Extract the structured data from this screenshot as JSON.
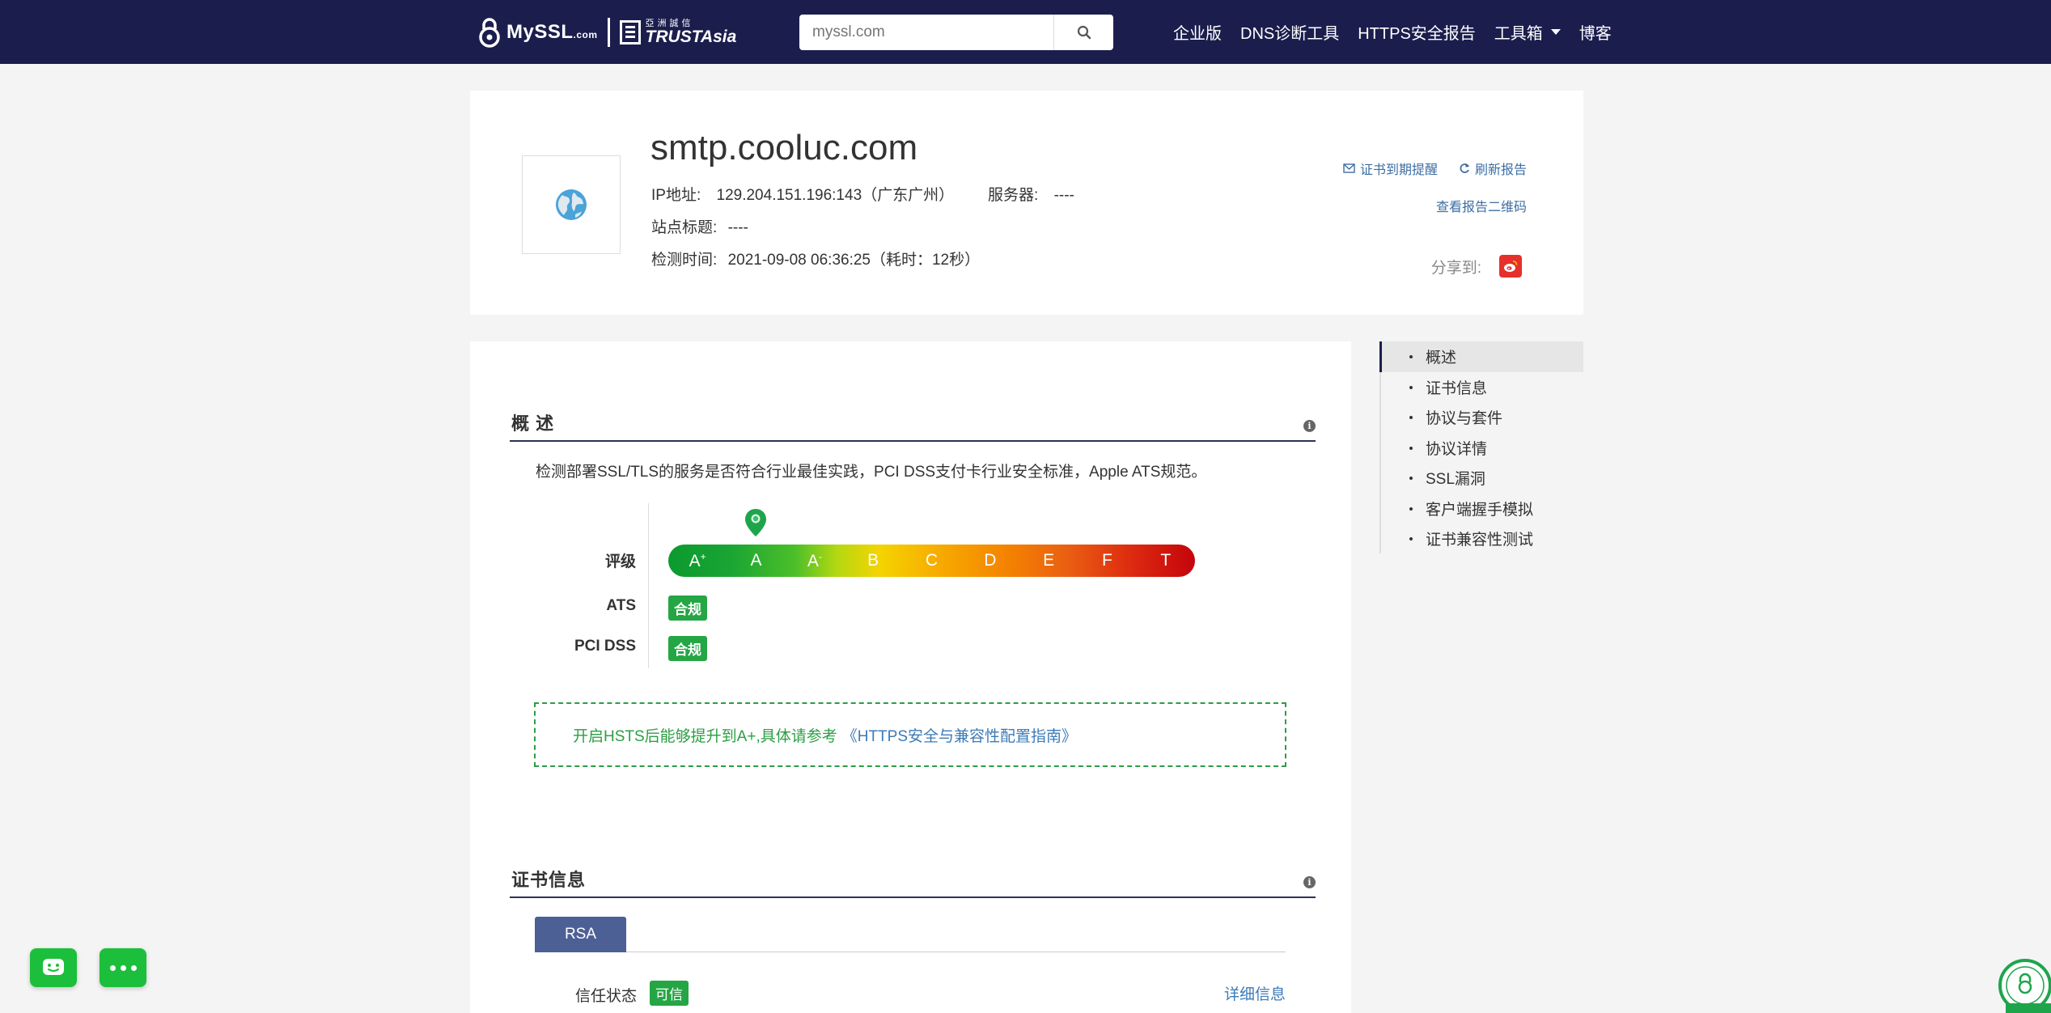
{
  "nav": {
    "logo_text": "MySSL",
    "logo_suffix": ".com",
    "partner_cn": "亞洲誠信",
    "partner_en": "TRUSTAsia",
    "search_placeholder": "myssl.com",
    "menu": [
      {
        "label": "企业版"
      },
      {
        "label": "DNS诊断工具"
      },
      {
        "label": "HTTPS安全报告"
      },
      {
        "label": "工具箱"
      },
      {
        "label": "博客"
      }
    ],
    "colors": {
      "bg": "#1b1e4d"
    }
  },
  "header": {
    "domain": "smtp.cooluc.com",
    "ip_label": "IP地址:",
    "ip_value": "129.204.151.196:143（广东广州）",
    "server_label": "服务器:",
    "server_value": "----",
    "site_title_label": "站点标题:",
    "site_title_value": "----",
    "check_time_label": "检测时间:",
    "check_time_value": "2021-09-08 06:36:25（耗时：12秒）",
    "cert_reminder": "证书到期提醒",
    "refresh_report": "刷新报告",
    "qr_report": "查看报告二维码",
    "share_label": "分享到:"
  },
  "overview": {
    "title": "概 述",
    "description": "检测部署SSL/TLS的服务是否符合行业最佳实践，PCI DSS支付卡行业安全标准，Apple ATS规范。",
    "grade_label": "评级",
    "grades": [
      "A+",
      "A",
      "A-",
      "B",
      "C",
      "D",
      "E",
      "F",
      "T"
    ],
    "current_grade": "A",
    "ats_label": "ATS",
    "ats_value": "合规",
    "pci_label": "PCI DSS",
    "pci_value": "合规",
    "tip_text": "开启HSTS后能够提升到A+,具体请参考",
    "tip_link": "《HTTPS安全与兼容性配置指南》"
  },
  "cert": {
    "title": "证书信息",
    "tab": "RSA",
    "trust_label": "信任状态",
    "trust_value": "可信",
    "detail_link": "详细信息"
  },
  "sidebar": {
    "items": [
      {
        "label": "概述",
        "active": true
      },
      {
        "label": "证书信息"
      },
      {
        "label": "协议与套件"
      },
      {
        "label": "协议详情"
      },
      {
        "label": "SSL漏洞"
      },
      {
        "label": "客户端握手模拟"
      },
      {
        "label": "证书兼容性测试"
      }
    ]
  }
}
